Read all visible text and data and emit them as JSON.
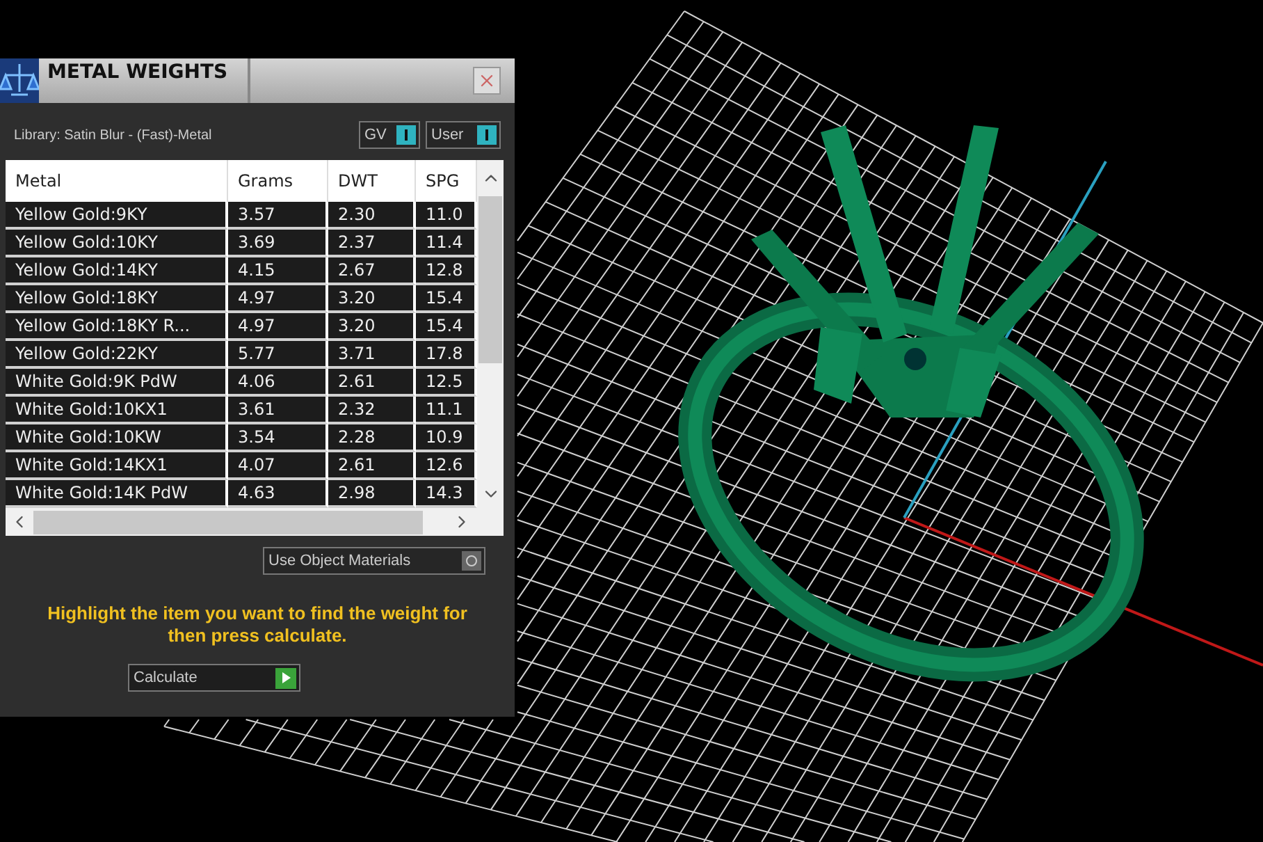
{
  "panel": {
    "title": "METAL WEIGHTS",
    "library": "Library: Satin Blur - (Fast)-Metal",
    "toggles": [
      {
        "label": "GV",
        "on": true
      },
      {
        "label": "User",
        "on": true
      }
    ],
    "table": {
      "columns": [
        "Metal",
        "Grams",
        "DWT",
        "SPG"
      ],
      "rows": [
        {
          "cells": [
            "Yellow Gold:9KY",
            "3.57",
            "2.30",
            "11.0"
          ],
          "selected": false
        },
        {
          "cells": [
            "Yellow Gold:10KY",
            "3.69",
            "2.37",
            "11.4"
          ],
          "selected": false
        },
        {
          "cells": [
            "Yellow Gold:14KY",
            "4.15",
            "2.67",
            "12.8"
          ],
          "selected": false
        },
        {
          "cells": [
            "Yellow Gold:18KY",
            "4.97",
            "3.20",
            "15.4"
          ],
          "selected": false
        },
        {
          "cells": [
            "Yellow Gold:18KY R...",
            "4.97",
            "3.20",
            "15.4"
          ],
          "selected": false
        },
        {
          "cells": [
            "Yellow Gold:22KY",
            "5.77",
            "3.71",
            "17.8"
          ],
          "selected": false
        },
        {
          "cells": [
            "White Gold:9K PdW",
            "4.06",
            "2.61",
            "12.5"
          ],
          "selected": false
        },
        {
          "cells": [
            "White Gold:10KX1",
            "3.61",
            "2.32",
            "11.1"
          ],
          "selected": false
        },
        {
          "cells": [
            "White Gold:10KW",
            "3.54",
            "2.28",
            "10.9"
          ],
          "selected": false
        },
        {
          "cells": [
            "White Gold:14KX1",
            "4.07",
            "2.61",
            "12.6"
          ],
          "selected": false
        },
        {
          "cells": [
            "White Gold:14K PdW",
            "4.63",
            "2.98",
            "14.3"
          ],
          "selected": false
        }
      ]
    },
    "object_materials": {
      "label": "Use Object Materials",
      "on": false
    },
    "hint": "Highlight the item you want to find the weight for then press calculate.",
    "calculate": "Calculate"
  }
}
